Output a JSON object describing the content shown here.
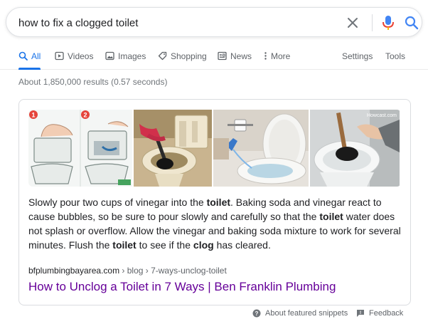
{
  "search": {
    "query": "how to fix a clogged toilet"
  },
  "tabs": [
    {
      "label": "All",
      "icon": "search-icon",
      "active": true
    },
    {
      "label": "Videos",
      "icon": "play-icon"
    },
    {
      "label": "Images",
      "icon": "image-icon"
    },
    {
      "label": "Shopping",
      "icon": "tag-icon"
    },
    {
      "label": "News",
      "icon": "newspaper-icon"
    },
    {
      "label": "More",
      "icon": "vertical-dots-icon"
    }
  ],
  "tools": {
    "settings_label": "Settings",
    "tools_label": "Tools"
  },
  "result_stats": "About 1,850,000 results (0.57 seconds)",
  "featured_snippet": {
    "images": [
      {
        "description": "illustration-steps",
        "badge_1": "1",
        "badge_2": "2"
      },
      {
        "description": "plunger-in-toilet-photo"
      },
      {
        "description": "pouring-vinegar-photo"
      },
      {
        "description": "plunger-photo",
        "watermark": "Howcast.com"
      }
    ],
    "text_segments": [
      {
        "text": "Slowly pour two cups of vinegar into the "
      },
      {
        "text": "toilet",
        "bold": true
      },
      {
        "text": ". Baking soda and vinegar react to cause bubbles, so be sure to pour slowly and carefully so that the "
      },
      {
        "text": "toilet",
        "bold": true
      },
      {
        "text": " water does not splash or overflow. Allow the vinegar and baking soda mixture to work for several minutes. Flush the "
      },
      {
        "text": "toilet",
        "bold": true
      },
      {
        "text": " to see if the "
      },
      {
        "text": "clog",
        "bold": true
      },
      {
        "text": " has cleared."
      }
    ],
    "source_domain": "bfplumbingbayarea.com",
    "source_path": " › blog › 7-ways-unclog-toilet",
    "result_title": "How to Unclog a Toilet in 7 Ways | Ben Franklin Plumbing"
  },
  "footer": {
    "about_label": "About featured snippets",
    "feedback_label": "Feedback"
  },
  "colors": {
    "accent": "#1a73e8",
    "visited_link": "#660099",
    "mic_blue": "#4285f4",
    "mic_red": "#ea4335"
  }
}
